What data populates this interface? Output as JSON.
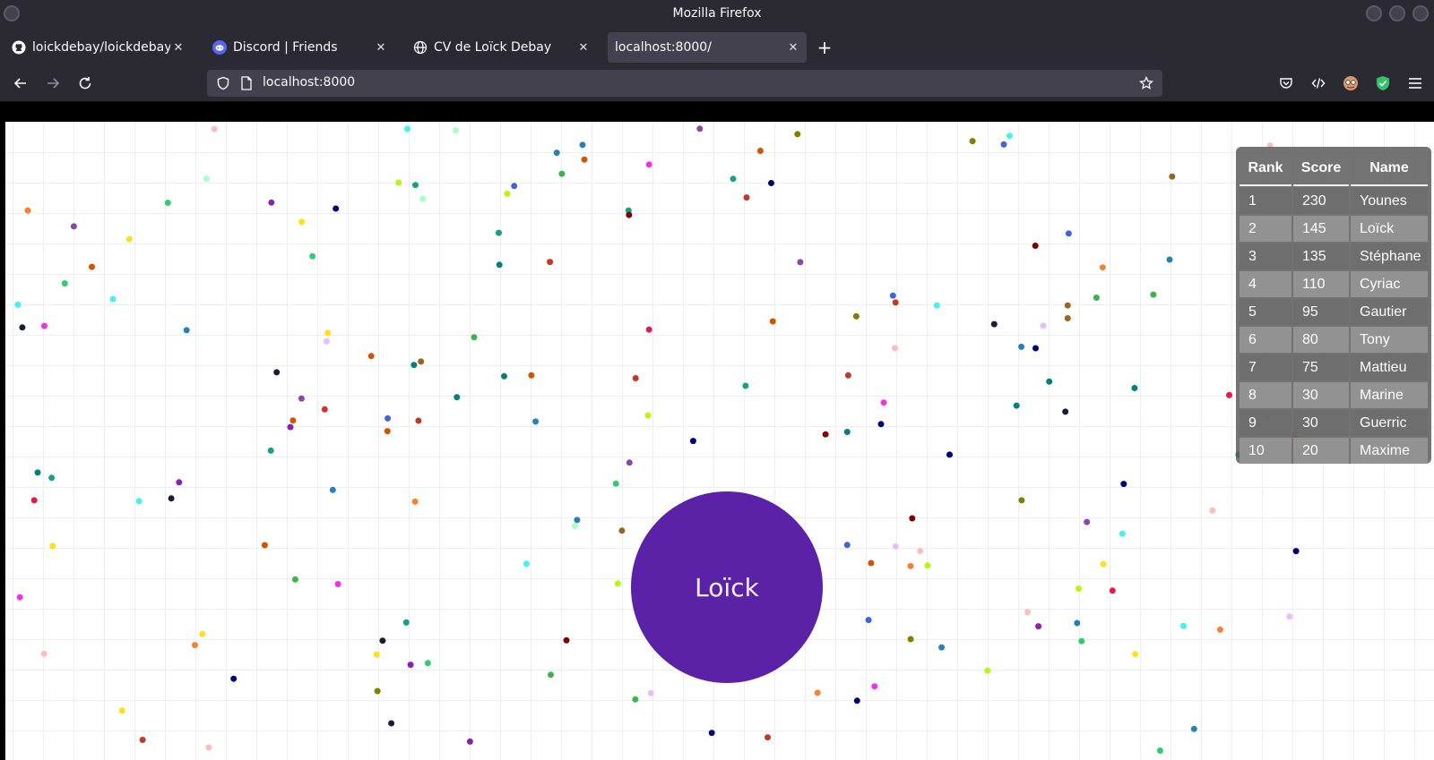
{
  "window": {
    "title": "Mozilla Firefox"
  },
  "tabs": [
    {
      "label": "loickdebay/loickdebay.gith",
      "icon": "github-icon"
    },
    {
      "label": "Discord | Friends",
      "icon": "discord-icon"
    },
    {
      "label": "CV de Loïck Debay",
      "icon": "globe-icon"
    },
    {
      "label": "localhost:8000/",
      "icon": "none",
      "active": true
    }
  ],
  "urlbar": {
    "url": "localhost:8000"
  },
  "game": {
    "player_name": "Loïck",
    "player_color": "#5b21a6",
    "leaderboard": {
      "headers": [
        "Rank",
        "Score",
        "Name"
      ],
      "rows": [
        [
          "1",
          "230",
          "Younes"
        ],
        [
          "2",
          "145",
          "Loïck"
        ],
        [
          "3",
          "135",
          "Stéphane"
        ],
        [
          "4",
          "110",
          "Cyriac"
        ],
        [
          "5",
          "95",
          "Gautier"
        ],
        [
          "6",
          "80",
          "Tony"
        ],
        [
          "7",
          "75",
          "Mattieu"
        ],
        [
          "8",
          "30",
          "Marine"
        ],
        [
          "9",
          "30",
          "Guerric"
        ],
        [
          "10",
          "20",
          "Maxime"
        ]
      ]
    }
  }
}
